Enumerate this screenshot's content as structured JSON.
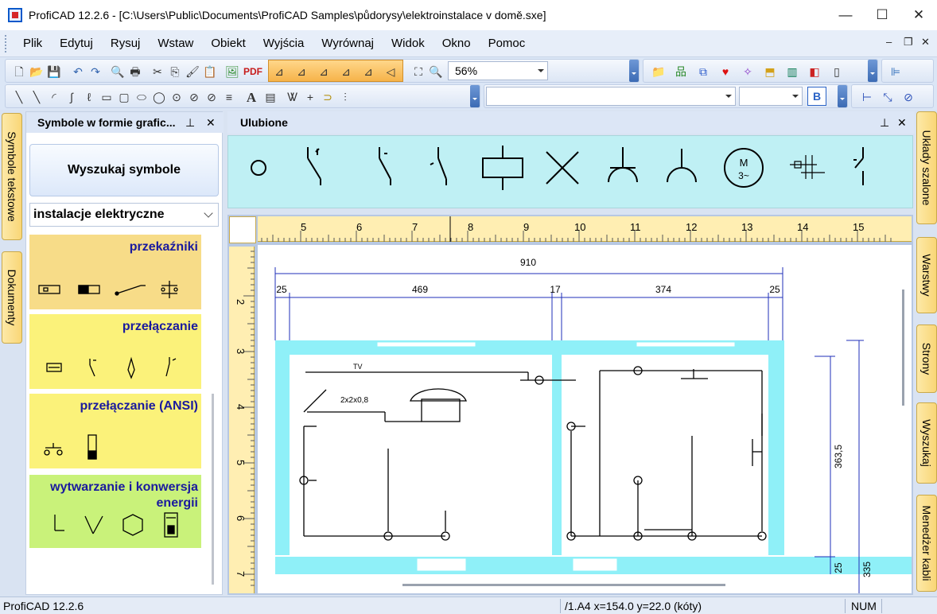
{
  "window": {
    "title": "ProfiCAD 12.2.6 - [C:\\Users\\Public\\Documents\\ProfiCAD Samples\\půdorysy\\elektroinstalace v domě.sxe]",
    "minimize": "—",
    "maximize": "☐",
    "close": "✕"
  },
  "menu": {
    "items": [
      "Plik",
      "Edytuj",
      "Rysuj",
      "Wstaw",
      "Obiekt",
      "Wyjścia",
      "Wyrównaj",
      "Widok",
      "Okno",
      "Pomoc"
    ],
    "mdi_min": "–",
    "mdi_restore": "❐",
    "mdi_close": "✕"
  },
  "toolbar": {
    "zoom_value": "56%",
    "pdf_label": "PDF",
    "bold_label": "B",
    "text_tool": "A"
  },
  "left_tabs": [
    "Symbole tekstowe",
    "Dokumenty"
  ],
  "right_tabs": [
    "Układy szalone",
    "Warstwy",
    "Strony",
    "Wyszukaj",
    "Menedżer kabli"
  ],
  "symbol_panel": {
    "title": "Symbole w formie grafic...",
    "pin": "⊥",
    "close": "✕",
    "search_button": "Wyszukaj symbole",
    "category": "instalacje elektryczne",
    "cards": [
      {
        "title": "przekaźniki"
      },
      {
        "title": "przełączanie"
      },
      {
        "title": "przełączanie (ANSI)"
      },
      {
        "title": "wytwarzanie i konwersja energii"
      }
    ]
  },
  "favorites": {
    "title": "Ulubione",
    "pin": "⊥",
    "close": "✕",
    "motor_symbol": [
      "M",
      "3~"
    ]
  },
  "rulers": {
    "horizontal": [
      "5",
      "6",
      "7",
      "8",
      "9",
      "10",
      "11",
      "12",
      "13",
      "14",
      "15"
    ],
    "vertical": [
      "2",
      "3",
      "4",
      "5",
      "6",
      "7"
    ]
  },
  "drawing": {
    "dimensions": {
      "total": "910",
      "segments": [
        "25",
        "469",
        "17",
        "374",
        "25"
      ],
      "right_height": "363,5",
      "right_small": "25",
      "right_cut": "335"
    },
    "labels": {
      "tv": "TV",
      "cable": "2x2x0,8"
    }
  },
  "status": {
    "app": "ProfiCAD 12.2.6",
    "coords": "/1.A4  x=154.0  y=22.0 (kóty)",
    "num": "NUM"
  },
  "colors": {
    "wall": "#8ff0f8",
    "dimension": "#1f2fb8",
    "ruler": "#ffeeb2",
    "favorites_bg": "#bff0f4",
    "card_orange": "#f7dc88",
    "card_yellow": "#fbf27a",
    "card_green": "#c9f27a",
    "card_title": "#1a1a9e"
  }
}
